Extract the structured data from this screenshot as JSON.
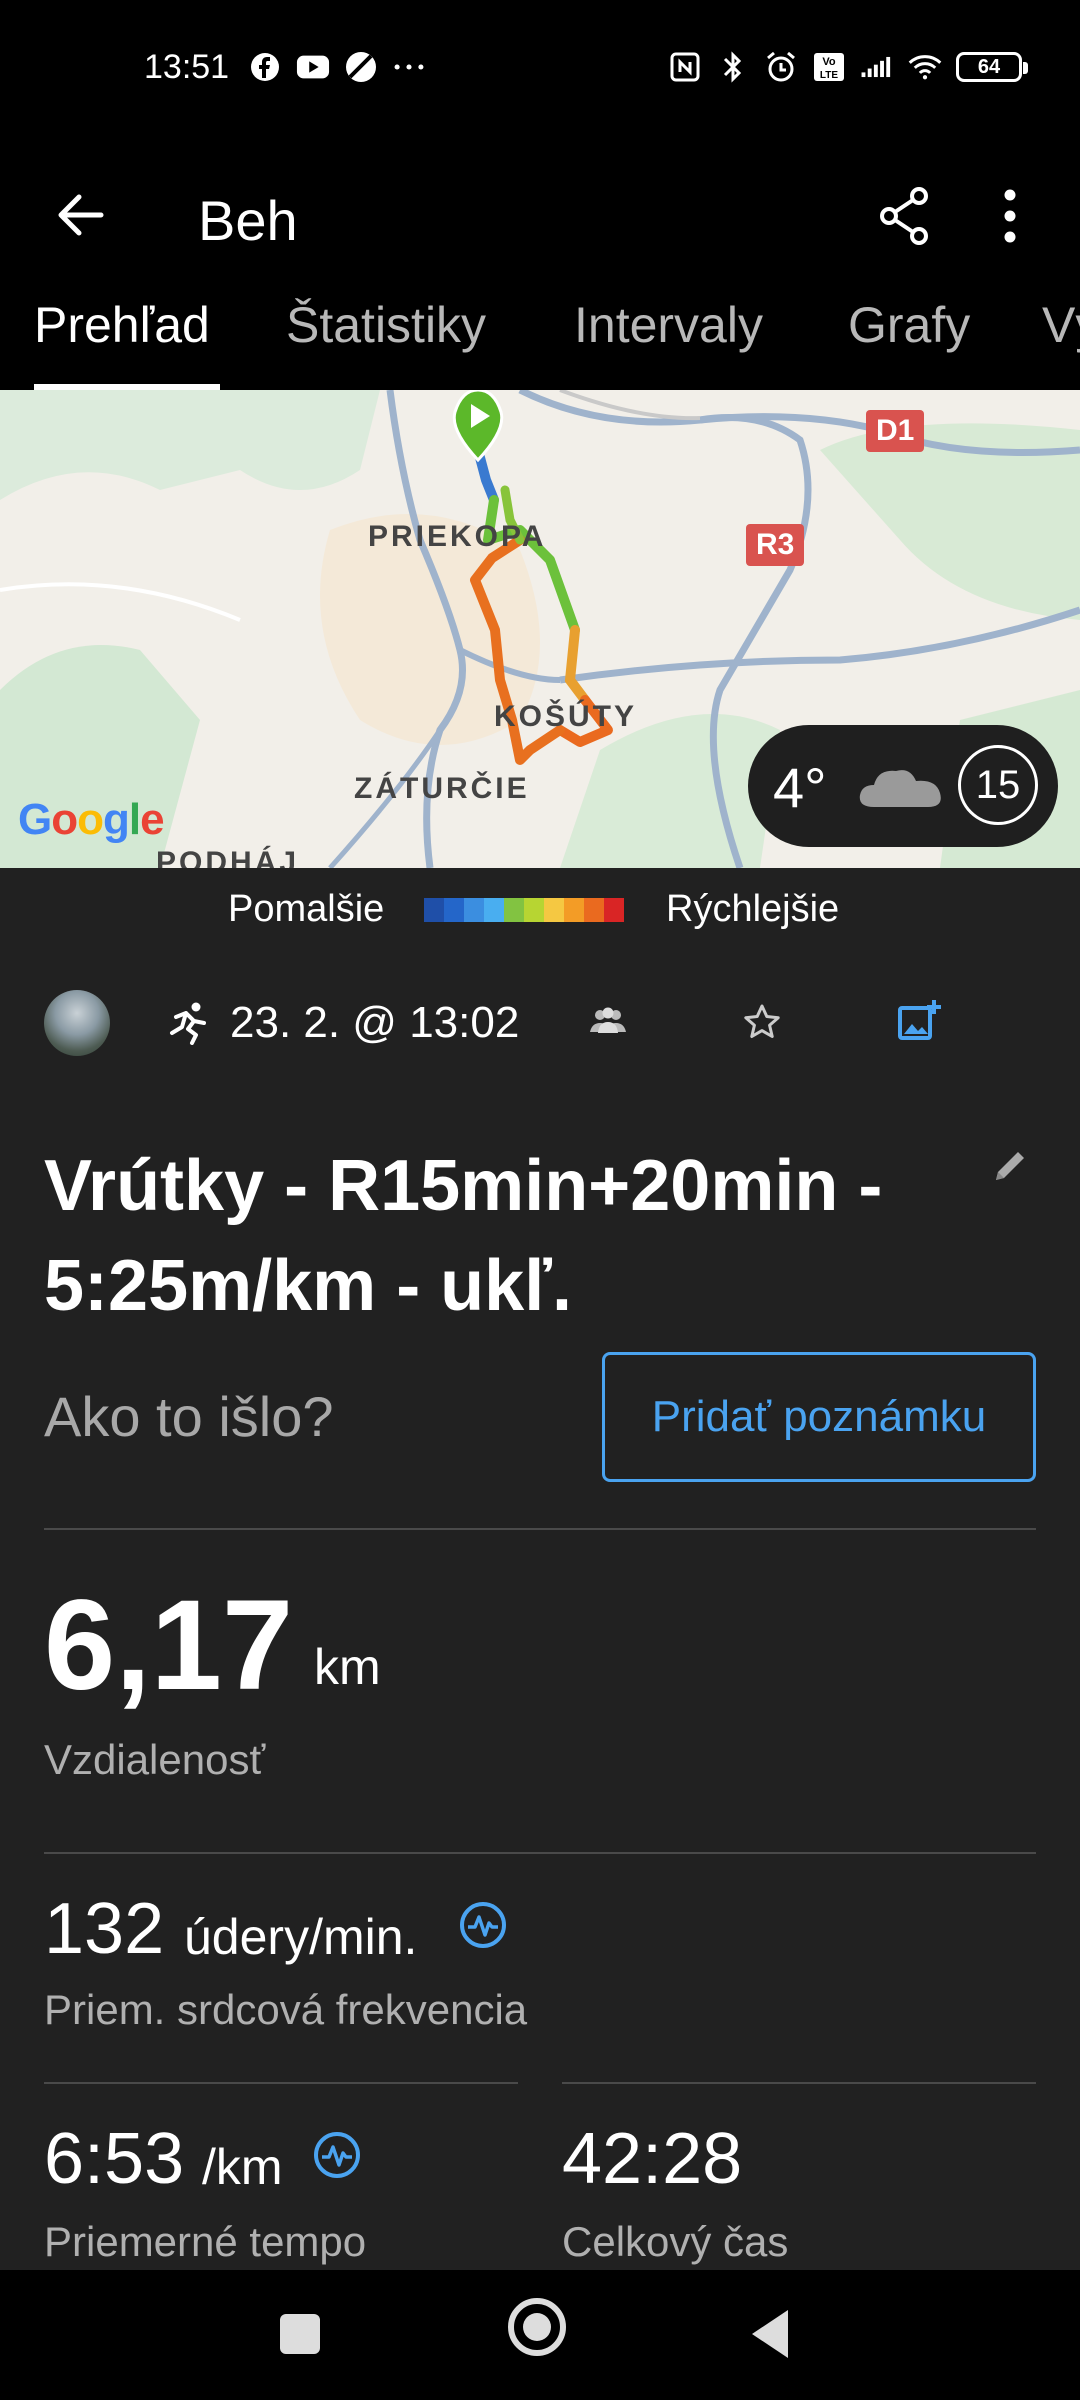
{
  "status_bar": {
    "time": "13:51",
    "left_icons": [
      "facebook-icon",
      "youtube-icon",
      "app-icon",
      "more-dots-icon"
    ],
    "right_icons": [
      "nfc-icon",
      "bluetooth-icon",
      "alarm-icon",
      "volte-icon",
      "signal-icon",
      "wifi-icon"
    ],
    "battery": "64"
  },
  "app_bar": {
    "title": "Beh"
  },
  "tabs": [
    "Prehľad",
    "Štatistiky",
    "Intervaly",
    "Grafy",
    "Vý"
  ],
  "map": {
    "labels": {
      "priekopa": "PRIEKOPA",
      "kosuty": "KOŠÚTY",
      "zaturcie": "ZÁTURČIE",
      "podhaj": "PODHÁJ"
    },
    "shields": {
      "d1": "D1",
      "r3": "R3"
    },
    "google": "Google",
    "weather": {
      "temp": "4°",
      "wind": "15"
    }
  },
  "legend": {
    "slow": "Pomalšie",
    "fast": "Rýchlejšie",
    "colors": [
      "#1f4fa8",
      "#2466c9",
      "#3b8ee0",
      "#49aef0",
      "#82c341",
      "#b7d532",
      "#f5c842",
      "#f39c26",
      "#ea6a1f",
      "#d92525"
    ]
  },
  "activity": {
    "date": "23. 2. @ 13:02",
    "title": "Vrútky - R15min+20min - 5:25m/km - ukľ.",
    "how_prompt": "Ako to išlo?",
    "add_note": "Pridať poznámku"
  },
  "stats": {
    "distance": {
      "value": "6,17",
      "unit": "km",
      "label": "Vzdialenosť"
    },
    "heart_rate": {
      "value": "132",
      "unit": "údery/min.",
      "label": "Priem. srdcová frekvencia"
    },
    "pace": {
      "value": "6:53",
      "unit": "/km",
      "label": "Priemerné tempo"
    },
    "total_time": {
      "value": "42:28",
      "label": "Celkový čas"
    }
  },
  "colors": {
    "accent": "#4aa3f0",
    "background": "#212121"
  }
}
